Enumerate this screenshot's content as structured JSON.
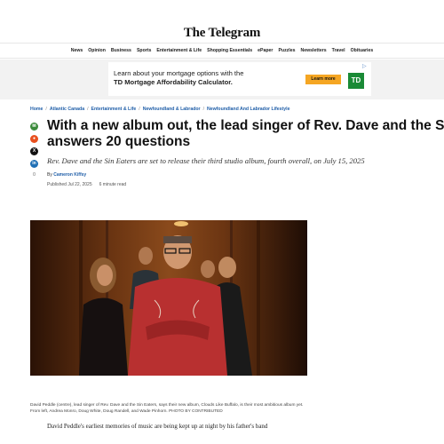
{
  "site": {
    "logo": "The Telegram"
  },
  "nav": [
    "News",
    "Opinion",
    "Business",
    "Sports",
    "Entertainment & Life",
    "Shopping Essentials",
    "ePaper",
    "Puzzles",
    "Newsletters",
    "Travel",
    "Obituaries"
  ],
  "ad": {
    "line1": "Learn about your mortgage options with the",
    "line2": "TD Mortgage Affordability Calculator.",
    "button": "Learn more",
    "logo": "TD",
    "close_icon": "ad-choices-icon"
  },
  "breadcrumb": [
    "Home",
    "Atlantic Canada",
    "Entertainment & Life",
    "Newfoundland & Labrador",
    "Newfoundland And Labrador Lifestyle"
  ],
  "share": {
    "buttons": [
      {
        "icon": "email-icon",
        "color": "#3a8a3a"
      },
      {
        "icon": "reddit-icon",
        "color": "#e8501f"
      },
      {
        "icon": "x-icon",
        "color": "#111111"
      },
      {
        "icon": "linkedin-icon",
        "color": "#1f6fb5"
      }
    ],
    "count": "0"
  },
  "article": {
    "headline_line1": "With a new album out, the lead singer of Rev. Dave and the Sin Eaters",
    "headline_line2": "answers 20 questions",
    "deck": "Rev. Dave and the Sin Eaters are set to release their third studio album, fourth overall, on July 15, 2025",
    "byline_prefix": "By",
    "author": "Cameron Kiffsy",
    "published": "Published Jul 22, 2025",
    "read_time": "6 minute read",
    "caption": "David Peddle (centre), lead singer of Rev. Dave and the Sin Eaters, says their new album, Clouds Like Buffalo, is their most ambitious album yet. From left, Andrea Monro, Doug White, Doug Randell, and Wade Pinhorn. PHOTO BY CONTRIBUTED",
    "body_first": "David Peddle's earliest memories of music are being kept up at night by his father's band"
  },
  "colors": {
    "link": "#1f5ea8",
    "ad_button": "#f5a623",
    "td_green": "#1a8a36"
  }
}
